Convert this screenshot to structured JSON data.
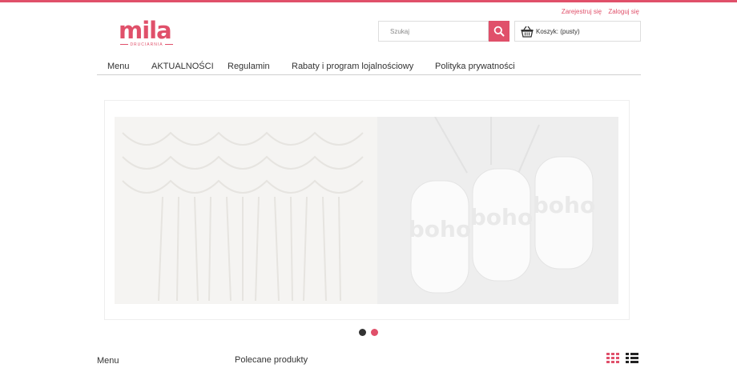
{
  "header": {
    "register_label": "Zarejestruj się",
    "login_label": "Zaloguj się",
    "logo_text": "mila",
    "logo_subtext": "DRUCIARNIA",
    "search_placeholder": "Szukaj",
    "cart_label": "Koszyk: (pusty)"
  },
  "nav": {
    "items": [
      "Menu",
      "AKTUALNOŚCI",
      "Regulamin",
      "Rabaty i program lojalnościowy",
      "Polityka prywatności"
    ]
  },
  "slider": {
    "active_index": 1,
    "image_text": [
      "boho",
      "boho",
      "boho"
    ]
  },
  "sections": {
    "sidebar_title": "Menu",
    "featured_title": "Polecane produkty"
  },
  "colors": {
    "accent": "#e0506a",
    "dot_inactive": "#333333",
    "dot_active": "#e0506a"
  },
  "icons": [
    "search-icon",
    "basket-icon",
    "grid-view-icon",
    "list-view-icon"
  ]
}
